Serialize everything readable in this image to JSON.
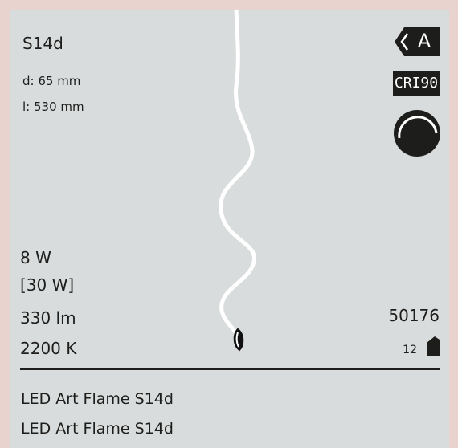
{
  "product": {
    "base": "S14d",
    "diameter": "d: 65 mm",
    "length": "l:  530 mm",
    "wattage": "8 W",
    "equivalent_wattage": "[30 W]",
    "luminous_flux": "330 lm",
    "color_temperature": "2200 K",
    "code": "50176",
    "pack_quantity": "12",
    "name_line1": "LED Art Flame S14d",
    "name_line2": "LED Art Flame S14d"
  },
  "badges": {
    "energy_class": "A",
    "cri": "CRI90"
  },
  "icons": [
    "energy-class-icon",
    "cri-badge",
    "dimmable-icon",
    "package-box-icon",
    "led-filament-bulb"
  ],
  "colors": {
    "background": "#e9d3cf",
    "card": "#d9dcdc",
    "text": "#1d1d1b",
    "badge": "#1d1d1b"
  }
}
